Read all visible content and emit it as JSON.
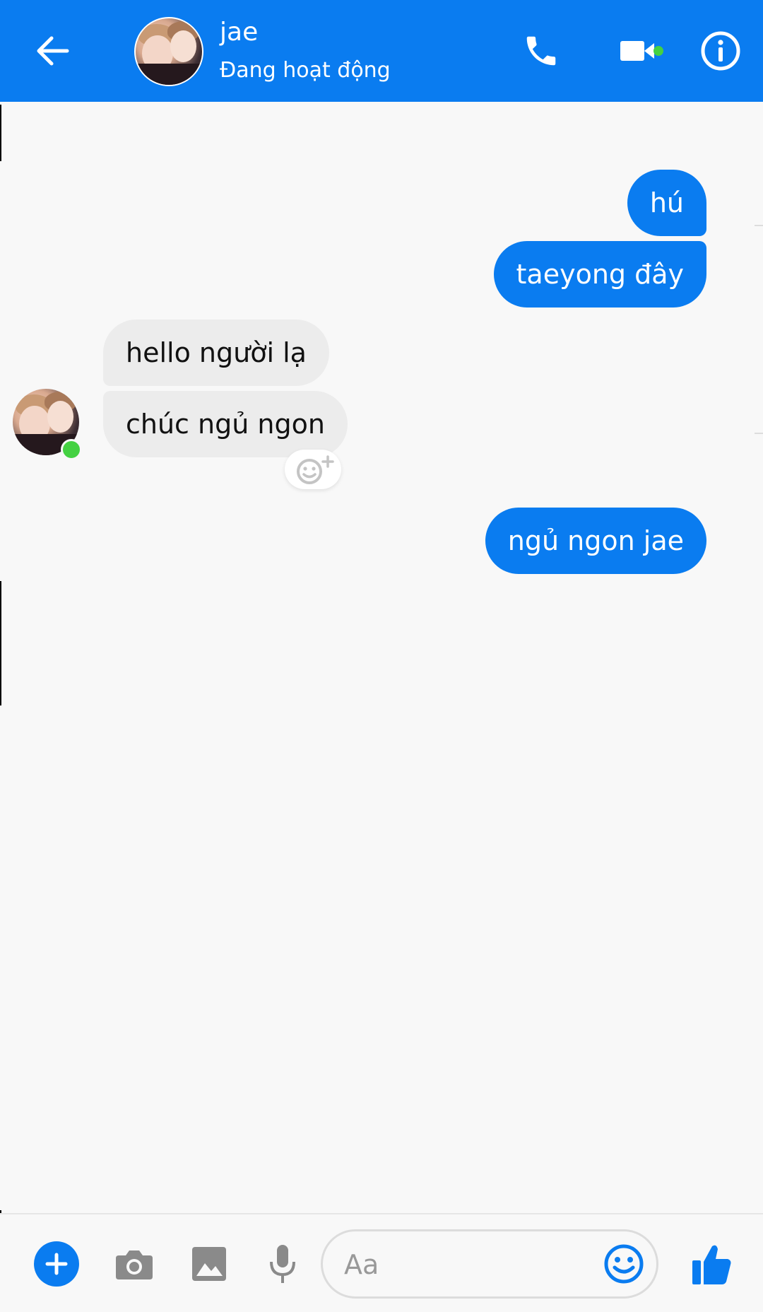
{
  "header": {
    "contact_name": "jae",
    "status": "Đang hoạt động",
    "icons": [
      "back-arrow-icon",
      "phone-icon",
      "video-camera-icon",
      "info-icon"
    ]
  },
  "messages": [
    {
      "from": "me",
      "text": "hú"
    },
    {
      "from": "me",
      "text": "taeyong đây"
    },
    {
      "from": "them",
      "text": "hello người lạ"
    },
    {
      "from": "them",
      "text": "chúc ngủ ngon"
    },
    {
      "from": "me",
      "text": "ngủ ngon jae"
    }
  ],
  "composer": {
    "placeholder": "Aa",
    "icons": [
      "plus-icon",
      "camera-icon",
      "image-icon",
      "microphone-icon",
      "emoji-icon",
      "thumbs-up-icon"
    ]
  },
  "colors": {
    "accent": "#0a7cf0",
    "online": "#44d142",
    "incoming_bubble": "#ececec",
    "background": "#f8f8f8"
  }
}
